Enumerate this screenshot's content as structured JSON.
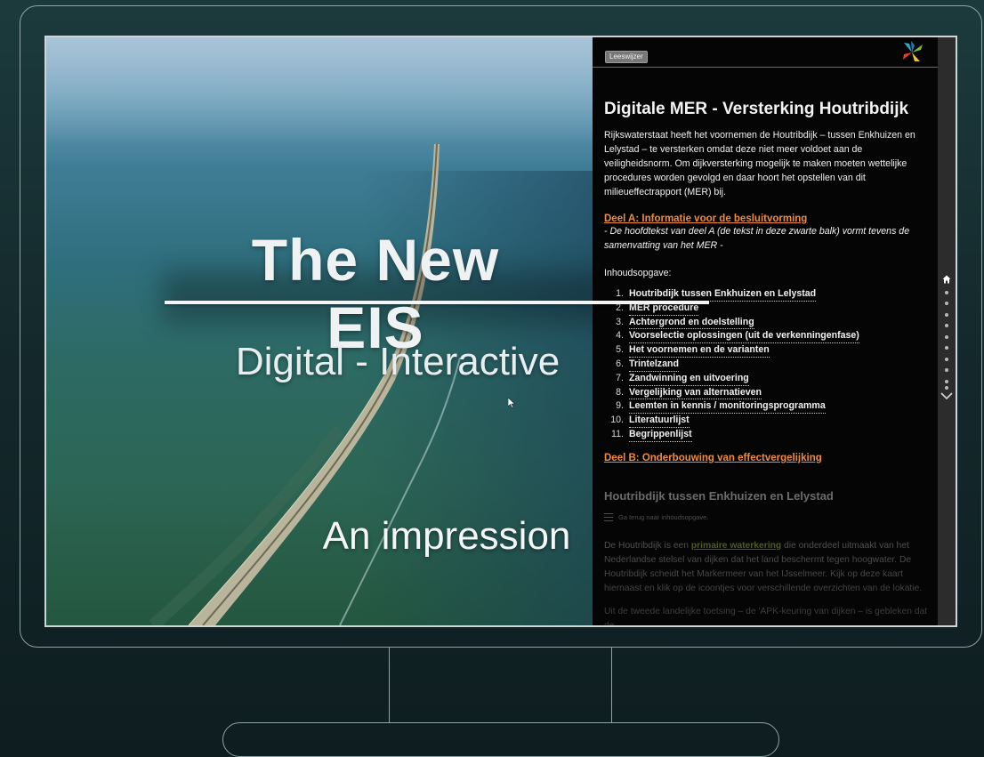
{
  "video": {
    "title": "The New EIS",
    "subtitle": "Digital - Interactive",
    "caption": "An impression"
  },
  "panel": {
    "toolbar": {
      "leeswijzer_label": "Leeswijzer"
    },
    "title": "Digitale MER - Versterking Houtribdijk",
    "intro": "Rijkswaterstaat heeft het voornemen de Houtribdijk – tussen Enkhuizen en Lelystad – te versterken omdat deze niet meer voldoet aan de veiligheidsnorm. Om dijkversterking mogelijk te maken moeten wettelijke procedures worden gevolgd en daar hoort het opstellen van dit milieueffectrapport (MER) bij.",
    "part_a": {
      "label": "Deel A: Informatie voor de besluitvorming",
      "note": "- De hoofdtekst van deel A (de tekst in deze zwarte balk) vormt tevens de samenvatting van het MER -"
    },
    "toc_heading": "Inhoudsopgave:",
    "toc": [
      {
        "num": "1.",
        "label": "Houtribdijk tussen Enkhuizen en Lelystad"
      },
      {
        "num": "2.",
        "label": "MER procedure"
      },
      {
        "num": "3.",
        "label": "Achtergrond en doelstelling"
      },
      {
        "num": "4.",
        "label": "Voorselectie oplossingen (uit de verkenningenfase)"
      },
      {
        "num": "5.",
        "label": "Het voornemen en de varianten"
      },
      {
        "num": "6.",
        "label": "Trintelzand"
      },
      {
        "num": "7.",
        "label": "Zandwinning en uitvoering"
      },
      {
        "num": "8.",
        "label": "Vergelijking van alternatieven"
      },
      {
        "num": "9.",
        "label": "Leemten in kennis / monitoringsprogramma"
      },
      {
        "num": "10.",
        "label": "Literatuurlijst"
      },
      {
        "num": "11.",
        "label": "Begrippenlijst"
      }
    ],
    "part_b": {
      "label": "Deel B: Onderbouwing van effectvergelijking"
    },
    "section": {
      "heading": "Houtribdijk tussen Enkhuizen en Lelystad",
      "back_link": "Ga terug naar inhoudsopgave.",
      "p1_before": "De Houtribdijk is een ",
      "p1_link": "primaire waterkering",
      "p1_after": " die onderdeel uitmaakt van het Nederlandse stelsel van dijken dat het land beschermt tegen hoogwater. De Houtribdijk scheidt het Markermeer van het IJsselmeer. Kijk op deze kaart hiernaast en klik op de icoontjes voor verschillende overzichten van de lokatie.",
      "p2": "Uit de tweede landelijke toetsing – de 'APK-keuring van dijken – is gebleken dat de"
    }
  },
  "nav": {
    "icons": [
      "home-icon",
      "chevron-down-icon"
    ],
    "dot_count": 10
  },
  "colors": {
    "accent_orange": "#f08b3a",
    "link_green": "#6f8b32",
    "panel_bg": "#050505"
  }
}
